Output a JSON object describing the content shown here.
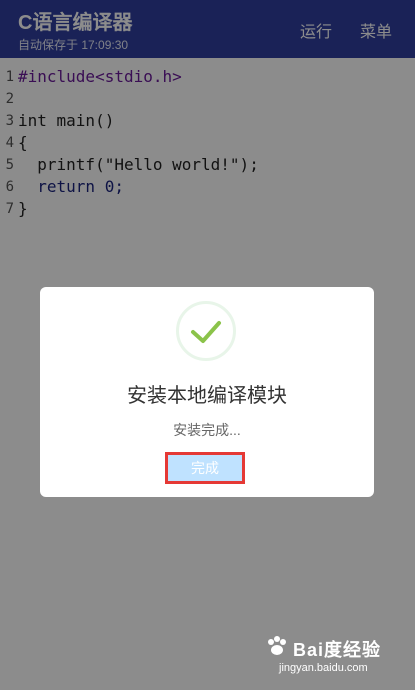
{
  "header": {
    "title": "C语言编译器",
    "subtitle": "自动保存于 17:09:30",
    "run_label": "运行",
    "menu_label": "菜单"
  },
  "editor": {
    "lines": [
      {
        "no": "1",
        "text": "#include<stdio.h>"
      },
      {
        "no": "2",
        "text": ""
      },
      {
        "no": "3",
        "text": "int main()"
      },
      {
        "no": "4",
        "text": "{"
      },
      {
        "no": "5",
        "text": "  printf(\"Hello world!\");"
      },
      {
        "no": "6",
        "text": "  return 0;"
      },
      {
        "no": "7",
        "text": "}"
      }
    ]
  },
  "dialog": {
    "icon": "check-icon",
    "title": "安装本地编译模块",
    "message": "安装完成...",
    "button_label": "完成",
    "accent": "#8bc34a",
    "button_highlight": "#e53935"
  },
  "watermark": {
    "brand": "Bai度经验",
    "url": "jingyan.baidu.com"
  },
  "colors": {
    "header_bg": "#303f9f"
  }
}
